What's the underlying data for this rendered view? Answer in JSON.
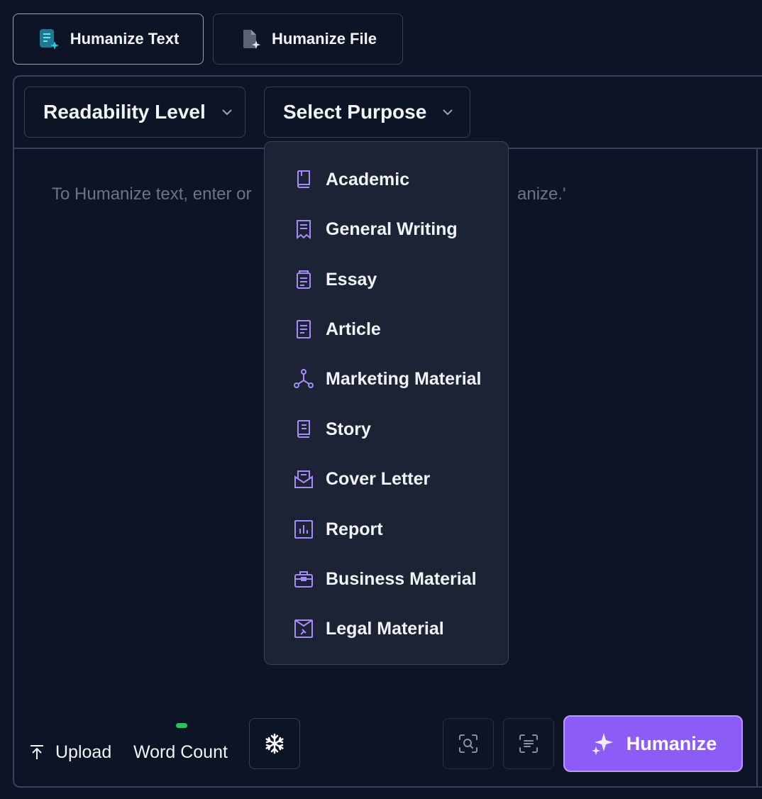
{
  "modes": {
    "text_label": "Humanize Text",
    "file_label": "Humanize File"
  },
  "selects": {
    "readability_label": "Readability Level",
    "purpose_label": "Select Purpose"
  },
  "editor": {
    "placeholder_left": "To Humanize text, enter or",
    "placeholder_right": "anize.'"
  },
  "purpose_menu": {
    "items": [
      {
        "label": "Academic",
        "icon": "book-icon"
      },
      {
        "label": "General Writing",
        "icon": "receipt-icon"
      },
      {
        "label": "Essay",
        "icon": "essay-icon"
      },
      {
        "label": "Article",
        "icon": "document-icon"
      },
      {
        "label": "Marketing Material",
        "icon": "network-icon"
      },
      {
        "label": "Story",
        "icon": "storybook-icon"
      },
      {
        "label": "Cover Letter",
        "icon": "mail-open-icon"
      },
      {
        "label": "Report",
        "icon": "bar-chart-icon"
      },
      {
        "label": "Business Material",
        "icon": "briefcase-icon"
      },
      {
        "label": "Legal Material",
        "icon": "gavel-icon"
      }
    ]
  },
  "toolbar": {
    "upload_label": "Upload",
    "word_count_label": "Word Count",
    "humanize_label": "Humanize"
  },
  "colors": {
    "background": "#0d1425",
    "menu_background": "#1b2334",
    "accent": "#8b5cf6",
    "icon_purple": "#a78bfa",
    "status_green": "#22c55e"
  }
}
